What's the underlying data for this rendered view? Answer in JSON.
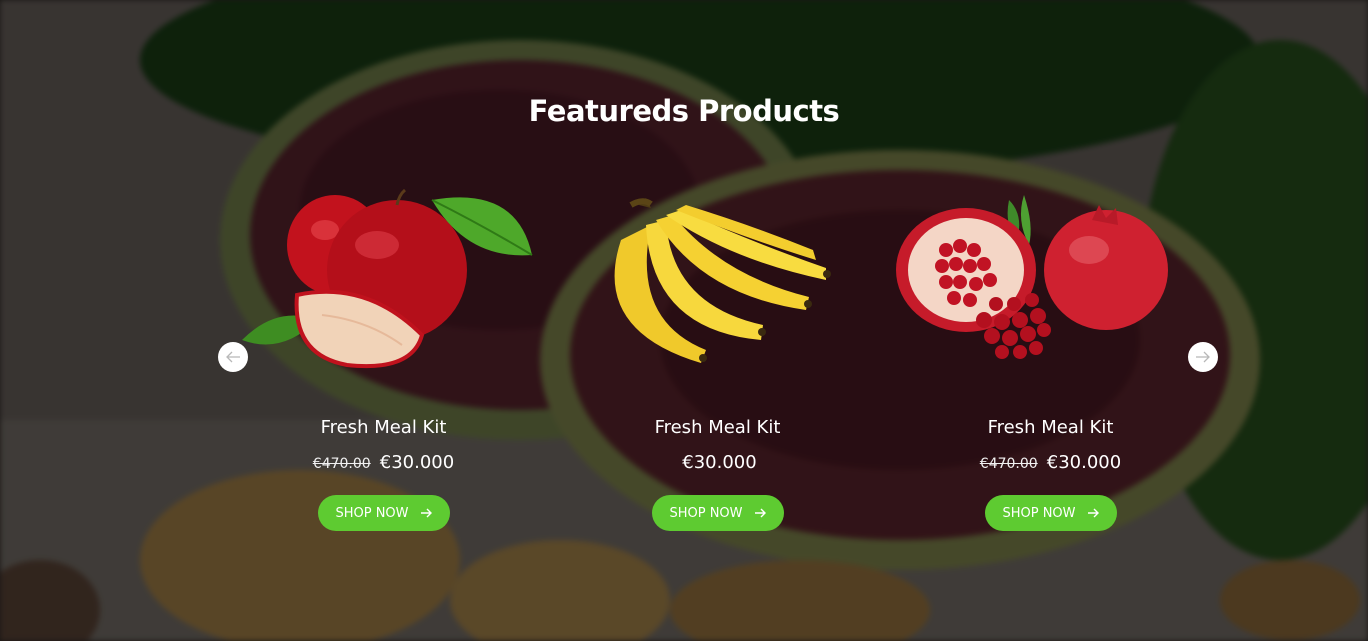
{
  "section": {
    "title": "Featureds Products"
  },
  "slider": {
    "prev_icon": "arrow-left-icon",
    "next_icon": "arrow-right-icon"
  },
  "products": [
    {
      "name": "Fresh Meal Kit",
      "old_price": "€470.00",
      "price": "€30.000",
      "button": "SHOP NOW",
      "image": "apples-image"
    },
    {
      "name": "Fresh Meal Kit",
      "old_price": "",
      "price": "€30.000",
      "button": "SHOP NOW",
      "image": "bananas-image"
    },
    {
      "name": "Fresh Meal Kit",
      "old_price": "€470.00",
      "price": "€30.000",
      "button": "SHOP NOW",
      "image": "pomegranate-image"
    }
  ],
  "colors": {
    "button": "#5ecb31",
    "text": "#ffffff"
  }
}
